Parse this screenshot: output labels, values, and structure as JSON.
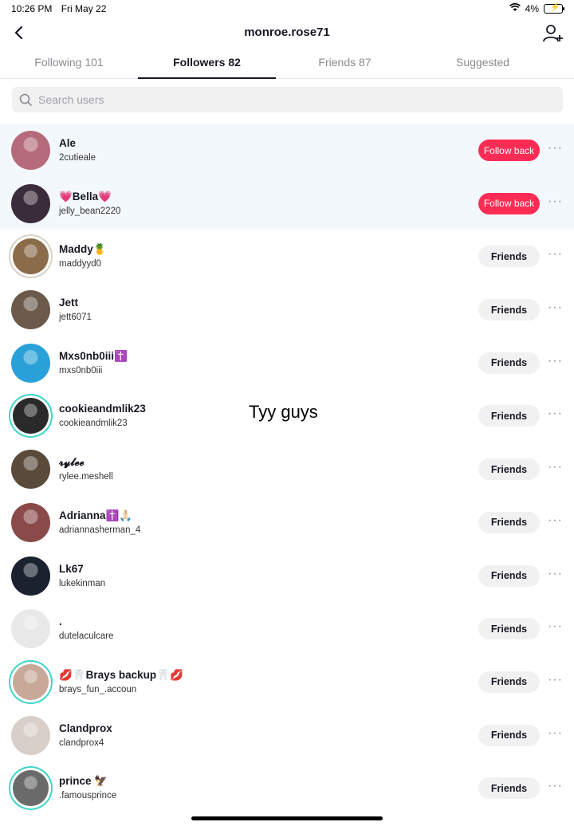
{
  "status_bar": {
    "time": "10:26 PM",
    "date": "Fri May 22",
    "battery": "4%"
  },
  "header": {
    "title": "monroe.rose71"
  },
  "tabs": [
    {
      "label": "Following 101"
    },
    {
      "label": "Followers 82"
    },
    {
      "label": "Friends 87"
    },
    {
      "label": "Suggested"
    }
  ],
  "search": {
    "placeholder": "Search users"
  },
  "users": [
    {
      "name": "Ale",
      "username": "2cutieale",
      "action": "Follow back",
      "avatar_color": "#b56b7a"
    },
    {
      "name": "💗Bella💗",
      "username": "jelly_bean2220",
      "action": "Follow back",
      "avatar_color": "#3a2c3a"
    },
    {
      "name": "Maddy🍍",
      "username": "maddyyd0",
      "action": "Friends",
      "avatar_color": "#8a6b4a"
    },
    {
      "name": "Jett",
      "username": "jett6071",
      "action": "Friends",
      "avatar_color": "#6b5a4a"
    },
    {
      "name": "Mxs0nb0iii✝️",
      "username": "mxs0nb0iii",
      "action": "Friends",
      "avatar_color": "#2aa0d8"
    },
    {
      "name": "cookieandmlik23",
      "username": "cookieandmlik23",
      "action": "Friends",
      "avatar_color": "#2a2a2a"
    },
    {
      "name": "𝓻𝔂𝓵𝓮𝓮",
      "username": "rylee.meshell",
      "action": "Friends",
      "avatar_color": "#5a4a3a"
    },
    {
      "name": "Adrianna✝️🙏🏻",
      "username": "adriannasherman_4",
      "action": "Friends",
      "avatar_color": "#8a4a4a"
    },
    {
      "name": "Lk67",
      "username": "lukekinman",
      "action": "Friends",
      "avatar_color": "#1a2230"
    },
    {
      "name": ".",
      "username": "dutelaculcare",
      "action": "Friends",
      "avatar_color": "#e8e8e8"
    },
    {
      "name": "💋🦷Brays backup🦷💋",
      "username": "brays_fun_.accoun",
      "action": "Friends",
      "avatar_color": "#c8a898"
    },
    {
      "name": "Clandprox",
      "username": "clandprox4",
      "action": "Friends",
      "avatar_color": "#d8d0c8"
    },
    {
      "name": "prince 🦅",
      "username": ".famousprince",
      "action": "Friends",
      "avatar_color": "#6a6a6a"
    }
  ],
  "more_label": "···",
  "overlay": {
    "text": "Tyy guys"
  },
  "colors": {
    "accent": "#fe2c55",
    "highlight_row": "#f3f8fc"
  }
}
